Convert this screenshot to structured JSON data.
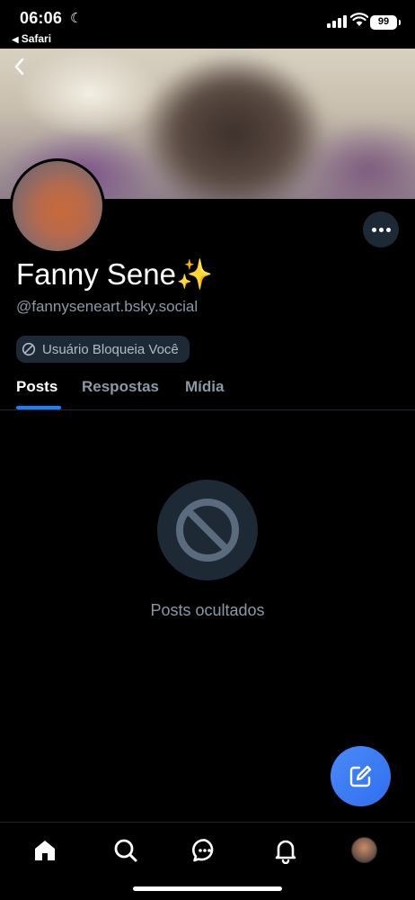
{
  "status_bar": {
    "time": "06:06",
    "back_app": "Safari",
    "battery": "99"
  },
  "profile": {
    "display_name": "Fanny Sene✨",
    "handle": "@fannyseneart.bsky.social",
    "blocked_badge": "Usuário Bloqueia Você"
  },
  "tabs": [
    {
      "label": "Posts",
      "active": true
    },
    {
      "label": "Respostas",
      "active": false
    },
    {
      "label": "Mídia",
      "active": false
    }
  ],
  "empty_state": {
    "message": "Posts ocultados"
  },
  "bottom_nav": {
    "items": [
      "home-icon",
      "search-icon",
      "chat-icon",
      "bell-icon",
      "profile-avatar"
    ]
  },
  "colors": {
    "accent": "#1083fe",
    "fab": "#3a7df3",
    "surface": "#1e2936",
    "muted_text": "#8b98a5"
  }
}
